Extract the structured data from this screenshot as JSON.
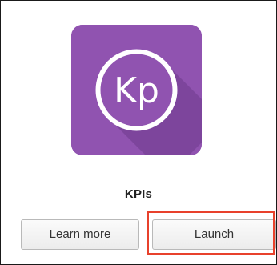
{
  "app": {
    "name": "KPIs",
    "icon_text": "Kp",
    "icon_name": "kpis-app-icon",
    "icon_color": "#9053b0",
    "icon_shadow_color": "#6d3a8c"
  },
  "actions": {
    "learn_more_label": "Learn more",
    "launch_label": "Launch"
  },
  "highlight": {
    "color": "#e8412c",
    "target": "launch-button"
  }
}
